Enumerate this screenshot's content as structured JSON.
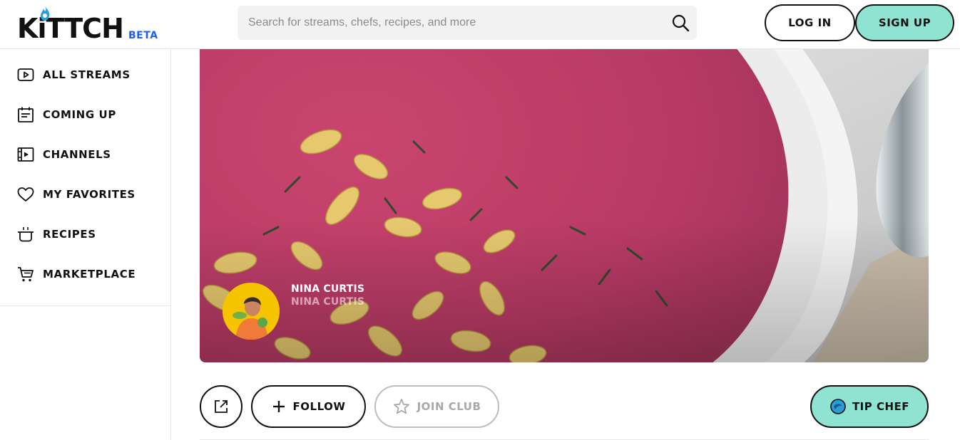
{
  "brand": {
    "name": "KiTTCH",
    "badge": "BETA",
    "badge_color": "#1d62e8"
  },
  "search": {
    "placeholder": "Search for streams, chefs, recipes, and more"
  },
  "auth": {
    "login_label": "LOG IN",
    "signup_label": "SIGN UP",
    "accent": "#8ee3d2"
  },
  "sidebar": {
    "items": [
      {
        "label": "ALL STREAMS",
        "icon": "play-icon"
      },
      {
        "label": "COMING UP",
        "icon": "calendar-icon"
      },
      {
        "label": "CHANNELS",
        "icon": "channel-icon"
      },
      {
        "label": "MY FAVORITES",
        "icon": "heart-icon"
      },
      {
        "label": "RECIPES",
        "icon": "pot-icon"
      },
      {
        "label": "MARKETPLACE",
        "icon": "cart-icon"
      }
    ]
  },
  "channel": {
    "chef_name": "NINA CURTIS",
    "chef_handle": "NINA CURTIS"
  },
  "actions": {
    "follow_label": "FOLLOW",
    "join_label": "JOIN CLUB",
    "tip_label": "TIP CHEF"
  }
}
